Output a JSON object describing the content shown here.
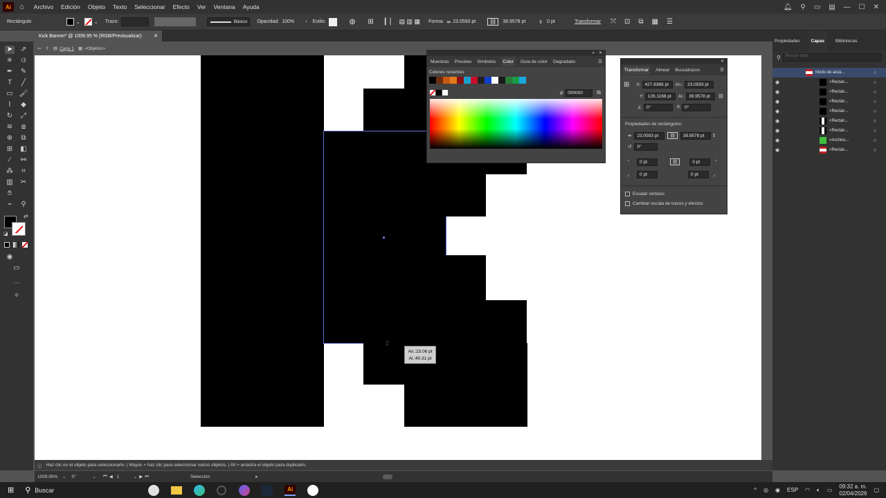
{
  "app": {
    "logo": "Ai"
  },
  "menu": [
    "Archivo",
    "Edición",
    "Objeto",
    "Texto",
    "Seleccionar",
    "Efecto",
    "Ver",
    "Ventana",
    "Ayuda"
  ],
  "control": {
    "selection_type": "Rectángulo",
    "stroke_label": "Trazo:",
    "brush_label": "Básico",
    "opacity_label": "Opacidad:",
    "opacity_value": "100%",
    "style_label": "Estilo:",
    "shape_label": "Forma:",
    "width": "23.0593 pt",
    "height": "39.9578 pt",
    "corner": "0 pt",
    "transform_label": "Transformar"
  },
  "document": {
    "tab_title": "Kick Banner* @ 1009.95 % (RGB/Previsualizar)",
    "breadcrumb_layer": "Capa 1",
    "breadcrumb_group": "<Objetos>"
  },
  "tooltip": {
    "w": "An.:23.06 pt",
    "h": "Al.:40.31 pt"
  },
  "color_panel": {
    "tabs": [
      "Muestras",
      "Pinceles",
      "Símbolos",
      "Color",
      "Guía de color",
      "Degradado"
    ],
    "active_tab": "Color",
    "recent_label": "Colores recientes",
    "hex": "000000",
    "recent_colors": [
      "#000000",
      "#6b2d0e",
      "#c65a12",
      "#e07a1a",
      "#8a1010",
      "#1aa0c8",
      "#c8102e",
      "#222222",
      "#1040c8",
      "#ffffff",
      "#1a1a1a",
      "#2a7a3a",
      "#1a9a4a",
      "#1aa8e0"
    ]
  },
  "transform_panel": {
    "tabs": [
      "Transformar",
      "Alinear",
      "Buscatrazos"
    ],
    "x_label": "X:",
    "x": "427.8368 pt",
    "y_label": "Y:",
    "y": "126.1168 pt",
    "w_label": "An.:",
    "w": "23.0593 pt",
    "h_label": "Al.:",
    "h": "39.9578 pt",
    "angle": "0°",
    "shear": "0°",
    "rect_props_label": "Propiedades de rectángulos:",
    "rect_w": "23.0593 pt",
    "rect_h": "39.9578 pt",
    "rect_angle": "0°",
    "corner_tl": "0 pt",
    "corner_tr": "0 pt",
    "corner_bl": "0 pt",
    "corner_br": "0 pt",
    "scale_corners": "Escalar vértices",
    "scale_strokes": "Cambiar escala de trazos y efectos"
  },
  "right_tabs": [
    "Propiedades",
    "Capas",
    "Bibliotecas"
  ],
  "right_active": "Capas",
  "layers_search_placeholder": "Buscar todo",
  "layers": [
    {
      "name": "Modo de aisla..."
    },
    {
      "name": "<Rectán..."
    },
    {
      "name": "<Rectán..."
    },
    {
      "name": "<Rectán..."
    },
    {
      "name": "<Rectán..."
    },
    {
      "name": "<Rectán..."
    },
    {
      "name": "<Rectán..."
    },
    {
      "name": "<Archivo..."
    },
    {
      "name": "<Rectán..."
    }
  ],
  "status": {
    "hint": "Haz clic en el objeto para seleccionarlo. | Mayús + haz clic para seleccionar varios objetos. | Alt + arrastra el objeto para duplicarlo.",
    "zoom": "1009.95%",
    "rotation": "0°",
    "artboard": "1",
    "tool": "Selección"
  },
  "taskbar": {
    "search": "Buscar",
    "lang": "ESP",
    "time": "09:32 a. m.",
    "date": "02/04/2026"
  }
}
